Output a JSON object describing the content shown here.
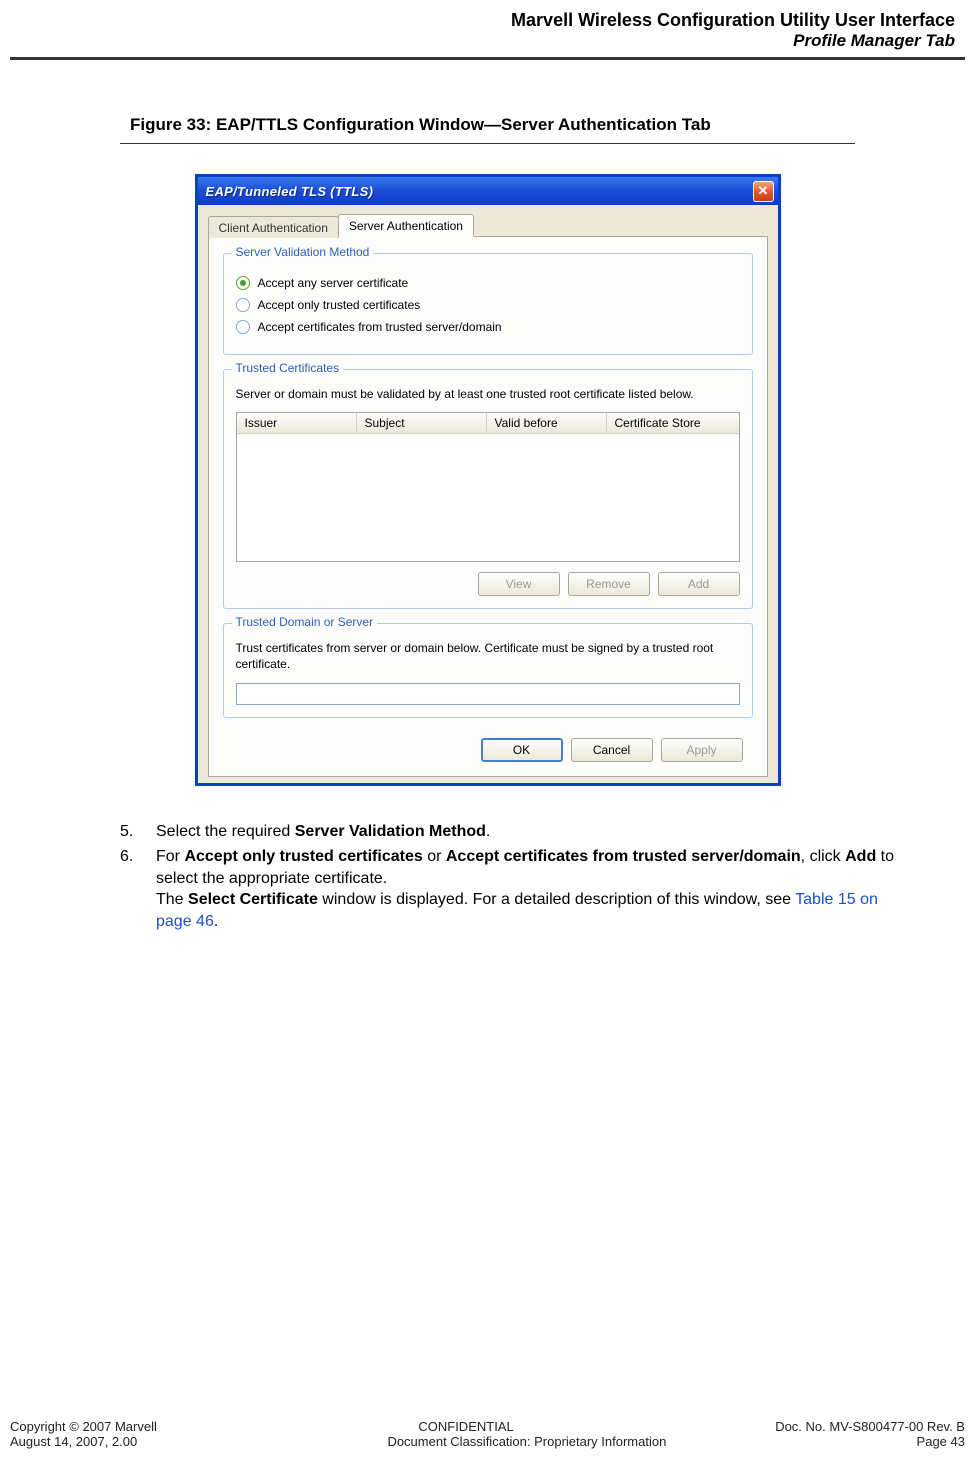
{
  "header": {
    "line1": "Marvell Wireless Configuration Utility User Interface",
    "line2": "Profile Manager Tab"
  },
  "figure_caption": "Figure 33: EAP/TTLS Configuration Window—Server Authentication Tab",
  "dialog": {
    "title": "EAP/Tunneled TLS (TTLS)",
    "tabs": {
      "client": "Client Authentication",
      "server": "Server Authentication"
    },
    "groups": {
      "validation": {
        "title": "Server Validation Method",
        "opt_any": "Accept any server certificate",
        "opt_trusted": "Accept only trusted certificates",
        "opt_domain": "Accept certificates from trusted server/domain"
      },
      "trusted_certs": {
        "title": "Trusted Certificates",
        "desc": "Server or domain must be validated by at least one trusted root certificate listed below.",
        "cols": {
          "issuer": "Issuer",
          "subject": "Subject",
          "valid": "Valid before",
          "store": "Certificate Store"
        },
        "buttons": {
          "view": "View",
          "remove": "Remove",
          "add": "Add"
        }
      },
      "trusted_domain": {
        "title": "Trusted Domain or Server",
        "desc": "Trust certificates from server or domain below. Certificate must be signed by a trusted root certificate."
      }
    },
    "footer_buttons": {
      "ok": "OK",
      "cancel": "Cancel",
      "apply": "Apply"
    }
  },
  "instructions": {
    "step5": {
      "num": "5.",
      "pre": "Select the required ",
      "b1": "Server Validation Method",
      "post": "."
    },
    "step6": {
      "num": "6.",
      "p1_a": "For ",
      "p1_b1": "Accept only trusted certificates",
      "p1_mid": " or ",
      "p1_b2": "Accept certificates from trusted server/domain",
      "p1_c": ", click ",
      "p1_b3": "Add",
      "p1_d": " to select the appropriate certificate.",
      "p2_a": "The ",
      "p2_b": "Select Certificate",
      "p2_c": " window is displayed. For a detailed description of this window, see ",
      "p2_link": "Table 15 on page 46",
      "p2_d": "."
    }
  },
  "footer": {
    "l1a": "Copyright © 2007 Marvell",
    "l1b": "CONFIDENTIAL",
    "l1c": "Doc. No. MV-S800477-00 Rev. B",
    "l2a": "August 14, 2007, 2.00",
    "l2b": "Document Classification: Proprietary Information",
    "l2c": "Page 43"
  }
}
